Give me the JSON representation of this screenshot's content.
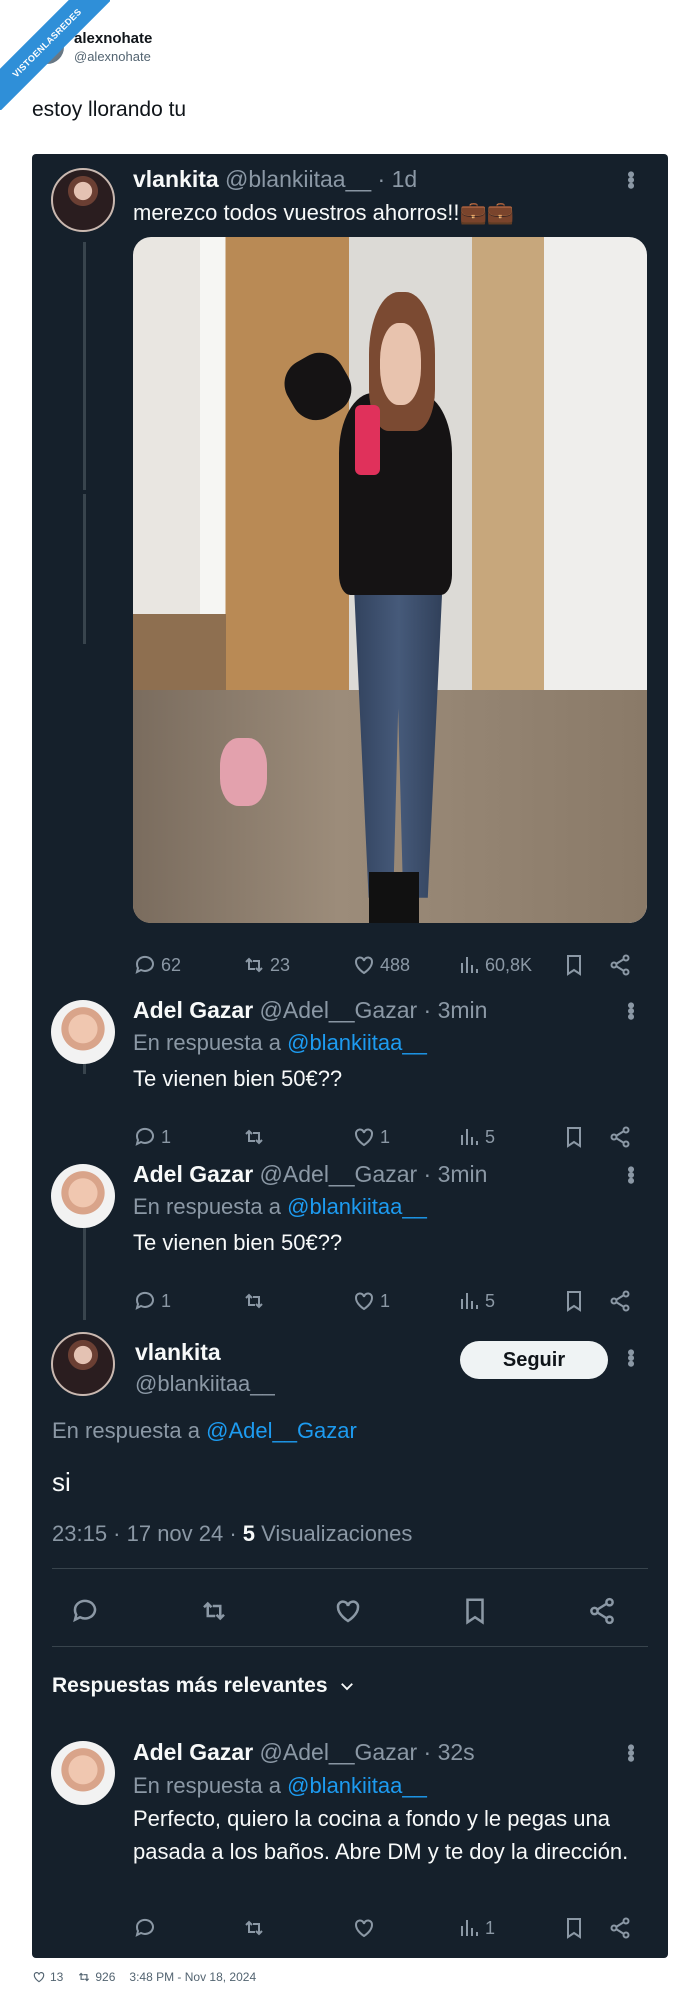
{
  "ribbon": "VISTOENLASREDES",
  "outer": {
    "name": "alexnohate",
    "handle": "@alexnohate",
    "text": "estoy llorando tu",
    "footer": {
      "likes": "13",
      "retweets": "926",
      "timestamp": "3:48 PM - Nov 18, 2024"
    }
  },
  "tweet1": {
    "name": "vlankita",
    "meta": "@blankiitaa__ · 1d",
    "text": "merezco todos vuestros ahorros!!💼💼",
    "stats": {
      "replies": "62",
      "retweets": "23",
      "likes": "488",
      "views": "60,8K"
    }
  },
  "tweet2": {
    "name": "Adel Gazar",
    "meta": "@Adel__Gazar · 3min",
    "reply_prefix": "En respuesta a ",
    "reply_to": "@blankiitaa__",
    "text": "Te vienen bien 50€??",
    "stats": {
      "replies": "1",
      "retweets": "",
      "likes": "1",
      "views": "5"
    }
  },
  "tweet3": {
    "name": "Adel Gazar",
    "meta": "@Adel__Gazar · 3min",
    "reply_prefix": "En respuesta a ",
    "reply_to": "@blankiitaa__",
    "text": "Te vienen bien 50€??",
    "stats": {
      "replies": "1",
      "retweets": "",
      "likes": "1",
      "views": "5"
    }
  },
  "focus": {
    "name": "vlankita",
    "handle": "@blankiitaa__",
    "follow_label": "Seguir",
    "reply_prefix": "En respuesta a ",
    "reply_to": "@Adel__Gazar",
    "text": "si",
    "time": "23:15 · 17 nov 24 · ",
    "views_count": "5",
    "views_label": " Visualizaciones"
  },
  "section": {
    "title": "Respuestas más relevantes"
  },
  "tweet4": {
    "name": "Adel Gazar",
    "meta": "@Adel__Gazar · 32s",
    "reply_prefix": "En respuesta a ",
    "reply_to": "@blankiitaa__",
    "text": "Perfecto, quiero la cocina a fondo y le pegas una pasada a los baños. Abre DM y te doy la dirección.",
    "stats": {
      "replies": "",
      "retweets": "",
      "likes": "",
      "views": "1"
    }
  },
  "colors": {
    "dark_bg": "#15202b",
    "accent": "#1d9bf0",
    "muted": "#8b98a5",
    "ribbon": "#2f8fd8"
  }
}
